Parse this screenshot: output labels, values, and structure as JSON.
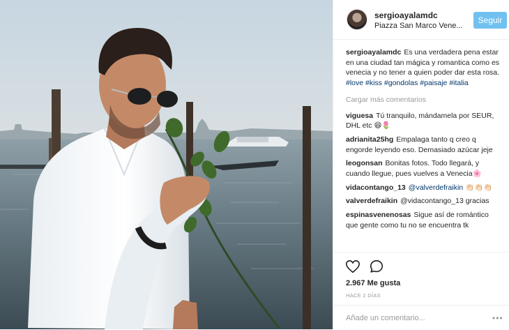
{
  "post": {
    "photo": {
      "description_icon": "photo-venice-man-rose"
    },
    "header": {
      "username": "sergioayalamdc",
      "location": "Piazza San Marco Vene...",
      "follow_label": "Seguir"
    },
    "caption": {
      "user": "sergioayalamdc",
      "text": "Es una verdadera pena estar en una ciudad tan mágica y romantica como es venecia y no tener a quien poder dar esta rosa.",
      "hashtags": [
        "#love",
        "#kiss",
        "#gondolas",
        "#paisaje",
        "#italia"
      ]
    },
    "load_more": "Cargar más comentarios",
    "comments": [
      {
        "user": "viguesa",
        "text": "Tú tranquilo, mándamela por SEUR, DHL etc 😄🌷"
      },
      {
        "user": "adrianita25hg",
        "text": "Empalaga tanto q creo q engorde leyendo eso. Demasiado azúcar jeje"
      },
      {
        "user": "leogonsan",
        "text": "Bonitas fotos. Todo llegará, y cuando llegue, pues vuelves a Venecia🌸"
      },
      {
        "user": "vidacontango_13",
        "text": "@valverdefraikin 👏🏻👏🏻👏🏻"
      },
      {
        "user": "valverdefraikin",
        "text": "@vidacontango_13 gracias"
      },
      {
        "user": "espinasvenenosas",
        "text": "Sigue así de romántico que gente como tu no se encuentra tk"
      }
    ],
    "likes": "2.967 Me gusta",
    "time": "HACE 2 DÍAS",
    "add_comment_placeholder": "Añade un comentario...",
    "more_options": "•••",
    "colors": {
      "follow": "#70c1f0",
      "hashtag": "#003569",
      "muted": "#999999"
    }
  }
}
